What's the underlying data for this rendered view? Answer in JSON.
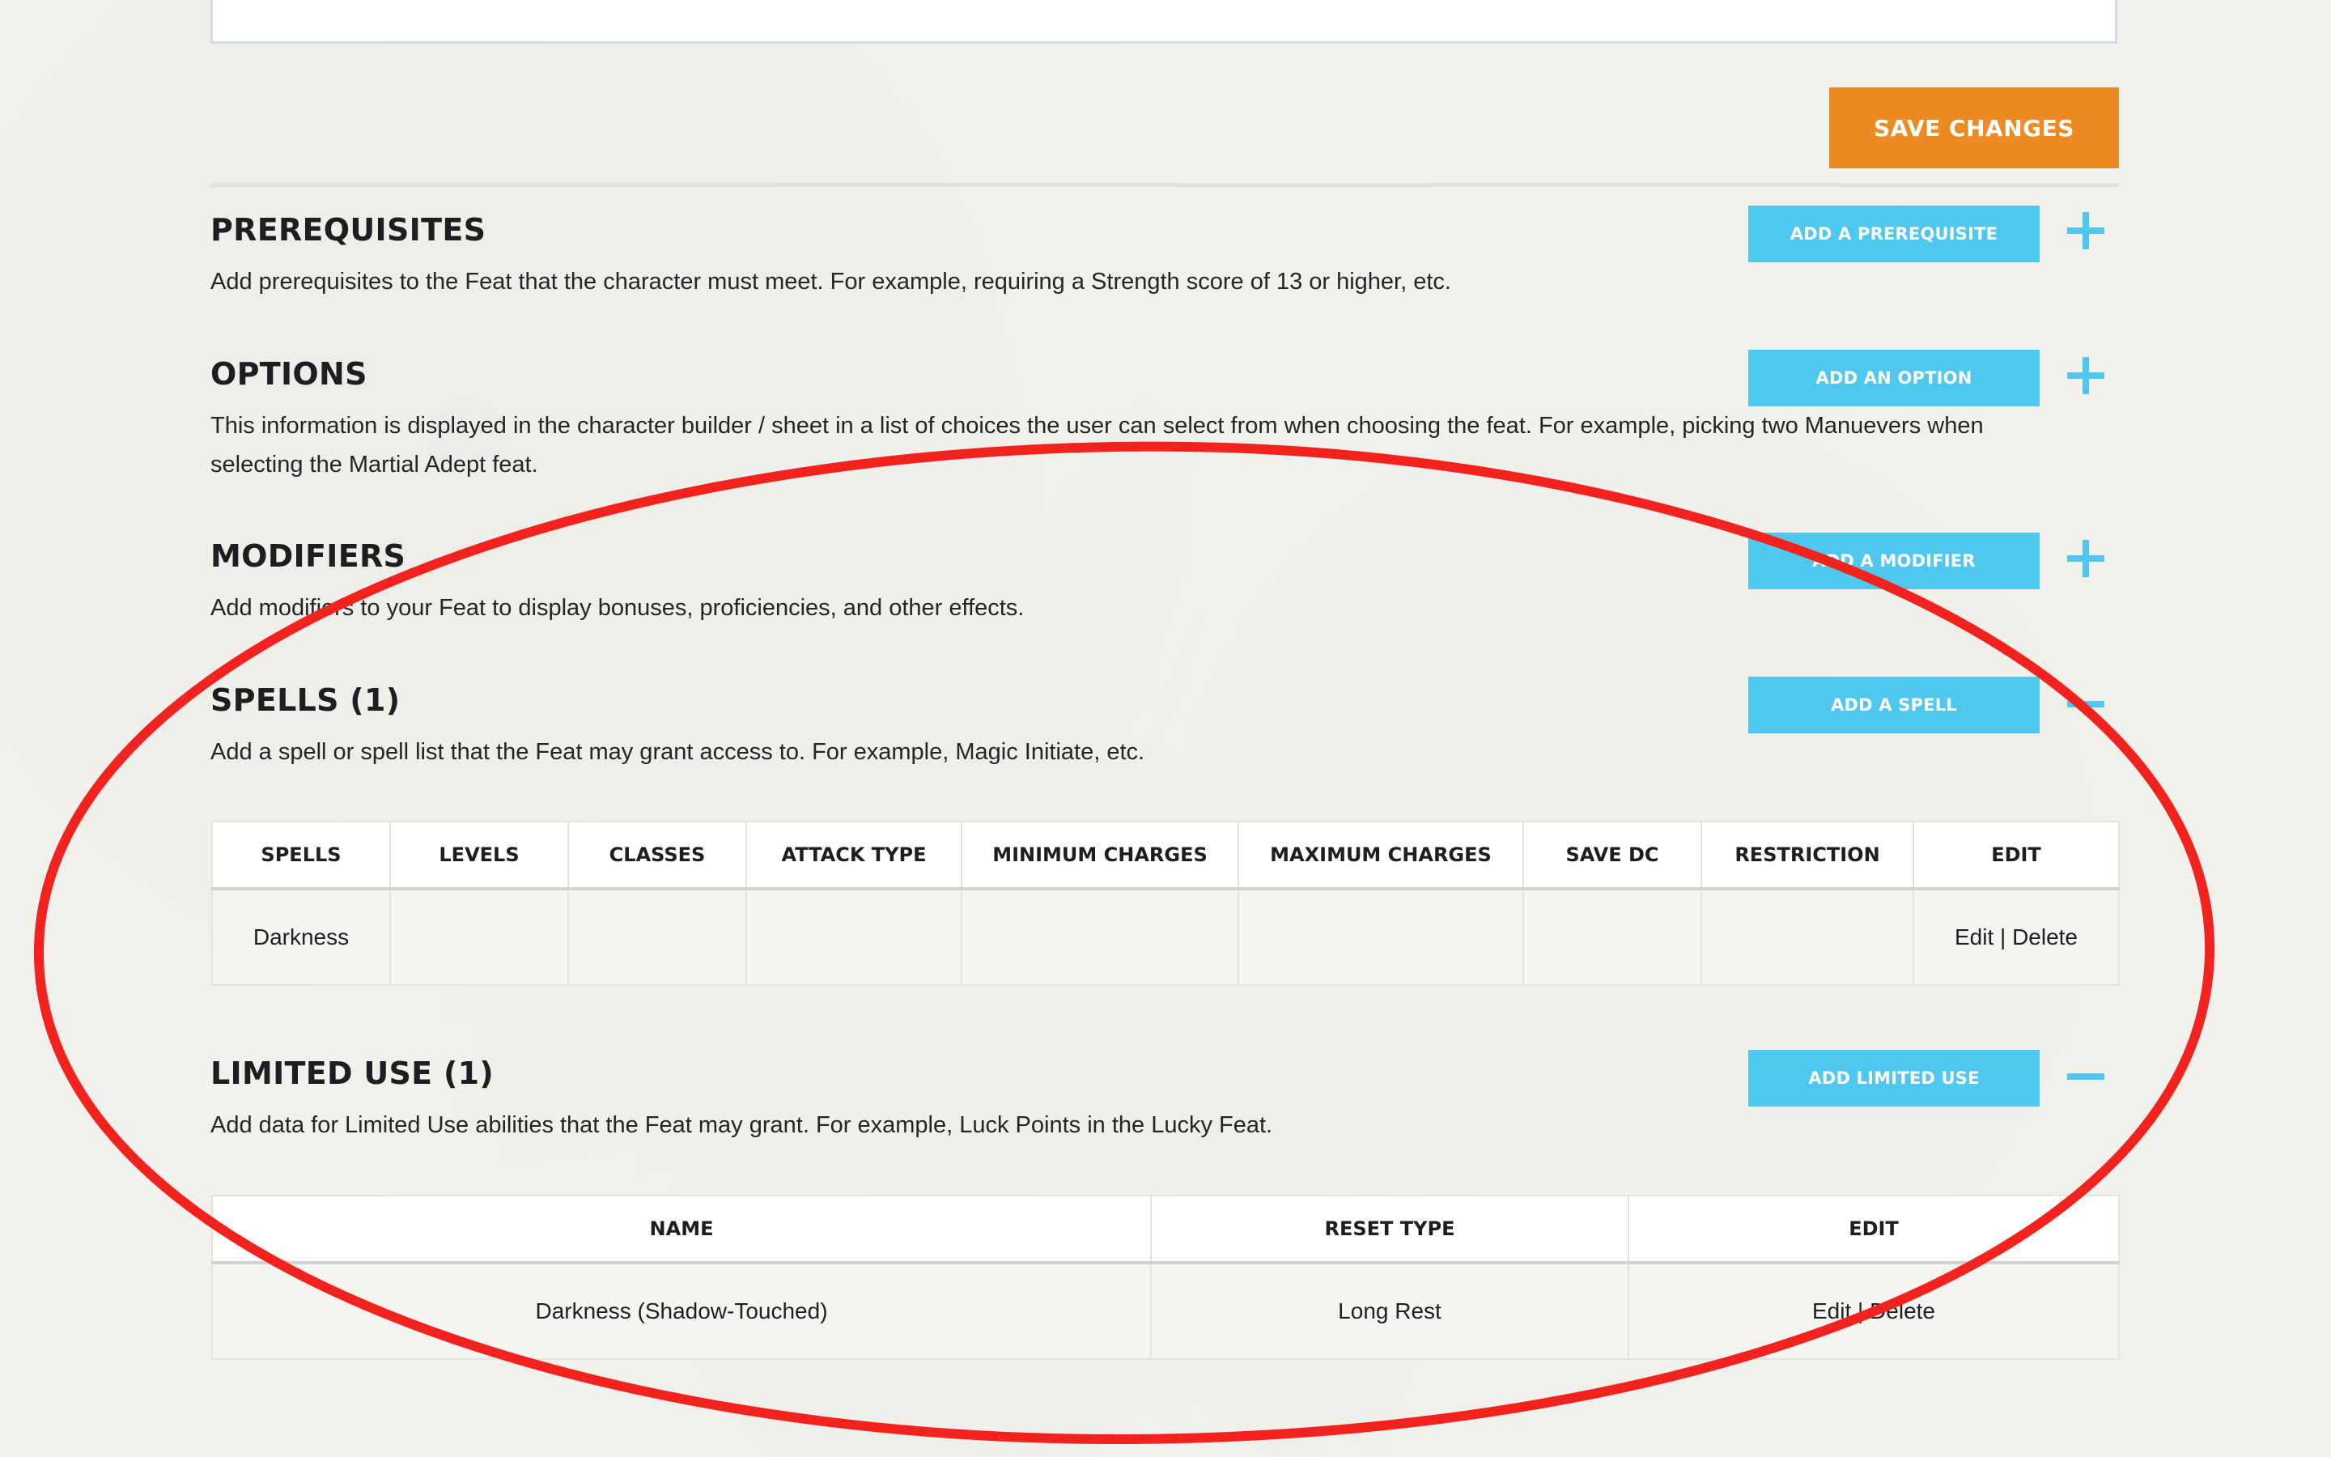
{
  "toolbar": {
    "save_label": "SAVE CHANGES"
  },
  "sections": {
    "prerequisites": {
      "title": "PREREQUISITES",
      "description": "Add prerequisites to the Feat that the character must meet. For example, requiring a Strength score of 13 or higher, etc.",
      "button": "ADD A PREREQUISITE",
      "toggle": "plus"
    },
    "options": {
      "title": "OPTIONS",
      "description": "This information is displayed in the character builder / sheet in a list of choices the user can select from when choosing the feat. For example, picking two Manuevers when selecting the Martial Adept feat.",
      "button": "ADD AN OPTION",
      "toggle": "plus"
    },
    "modifiers": {
      "title": "MODIFIERS",
      "description": "Add modifiers to your Feat to display bonuses, proficiencies, and other effects.",
      "button": "ADD A MODIFIER",
      "toggle": "plus"
    },
    "spells": {
      "title": "SPELLS (1)",
      "description": "Add a spell or spell list that the Feat may grant access to. For example, Magic Initiate, etc.",
      "button": "ADD A SPELL",
      "toggle": "minus",
      "columns": [
        "SPELLS",
        "LEVELS",
        "CLASSES",
        "ATTACK TYPE",
        "MINIMUM CHARGES",
        "MAXIMUM CHARGES",
        "SAVE DC",
        "RESTRICTION",
        "EDIT"
      ],
      "rows": [
        [
          "Darkness",
          "",
          "",
          "",
          "",
          "",
          "",
          "",
          "Edit | Delete"
        ]
      ]
    },
    "limited_use": {
      "title": "LIMITED USE (1)",
      "description": "Add data for Limited Use abilities that the Feat may grant. For example, Luck Points in the Lucky Feat.",
      "button": "ADD LIMITED USE",
      "toggle": "minus",
      "columns": [
        "NAME",
        "RESET TYPE",
        "EDIT"
      ],
      "rows": [
        [
          "Darkness (Shadow-Touched)",
          "Long Rest",
          "Edit | Delete"
        ]
      ]
    }
  },
  "colors": {
    "save_button": "#ec8a24",
    "add_button": "#4fc8ef",
    "annotation_ellipse": "#f2231e"
  },
  "icons": {
    "plus": "plus-icon",
    "minus": "minus-icon"
  }
}
